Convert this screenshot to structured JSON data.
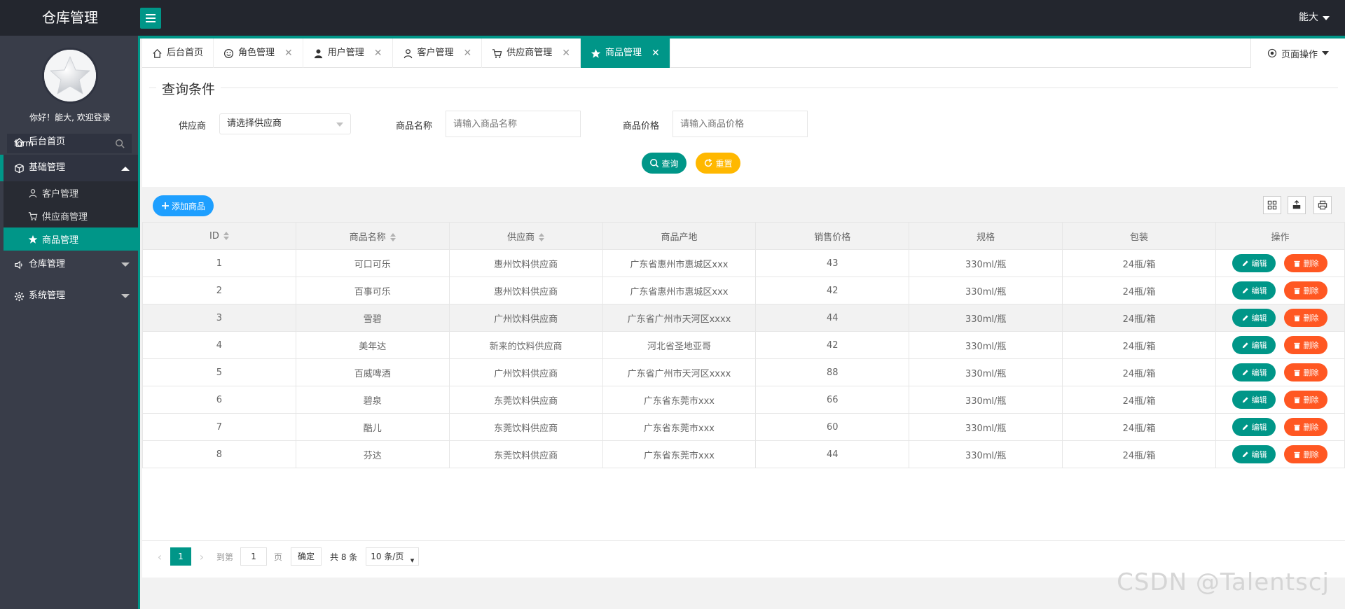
{
  "header": {
    "title": "仓库管理",
    "user": "能大"
  },
  "sidebar": {
    "welcome": "你好！能大, 欢迎登录",
    "search_value": "form",
    "items": [
      {
        "label": "后台首页",
        "icon": "home-icon"
      },
      {
        "label": "基础管理",
        "icon": "cube-icon"
      },
      {
        "label": "客户管理",
        "icon": "user-icon"
      },
      {
        "label": "供应商管理",
        "icon": "cart-icon"
      },
      {
        "label": "商品管理",
        "icon": "star-icon"
      },
      {
        "label": "仓库管理",
        "icon": "speaker-icon"
      },
      {
        "label": "系统管理",
        "icon": "gear-icon"
      }
    ]
  },
  "tabs": [
    {
      "label": "后台首页",
      "icon": "home-icon",
      "closable": false
    },
    {
      "label": "角色管理",
      "icon": "smile-icon",
      "closable": true
    },
    {
      "label": "用户管理",
      "icon": "user-icon",
      "closable": true
    },
    {
      "label": "客户管理",
      "icon": "user-outline-icon",
      "closable": true
    },
    {
      "label": "供应商管理",
      "icon": "cart-icon",
      "closable": true
    },
    {
      "label": "商品管理",
      "icon": "star-icon",
      "closable": true,
      "active": true
    }
  ],
  "tab_close_glyph": "✕",
  "page_ops_label": "页面操作",
  "query": {
    "legend": "查询条件",
    "supplier_label": "供应商",
    "supplier_value": "请选择供应商",
    "name_label": "商品名称",
    "name_placeholder": "请输入商品名称",
    "price_label": "商品价格",
    "price_placeholder": "请输入商品价格",
    "search_btn": "查询",
    "reset_btn": "重置"
  },
  "toolbar": {
    "add_btn": "添加商品"
  },
  "table": {
    "headers": [
      "ID",
      "商品名称",
      "供应商",
      "商品产地",
      "销售价格",
      "规格",
      "包装",
      "操作"
    ],
    "edit_label": "编辑",
    "delete_label": "删除",
    "rows": [
      [
        "1",
        "可口可乐",
        "惠州饮料供应商",
        "广东省惠州市惠城区xxx",
        "43",
        "330ml/瓶",
        "24瓶/箱"
      ],
      [
        "2",
        "百事可乐",
        "惠州饮料供应商",
        "广东省惠州市惠城区xxx",
        "42",
        "330ml/瓶",
        "24瓶/箱"
      ],
      [
        "3",
        "雪碧",
        "广州饮料供应商",
        "广东省广州市天河区xxxx",
        "44",
        "330ml/瓶",
        "24瓶/箱"
      ],
      [
        "4",
        "美年达",
        "新来的饮料供应商",
        "河北省圣地亚哥",
        "42",
        "330ml/瓶",
        "24瓶/箱"
      ],
      [
        "5",
        "百威啤酒",
        "广州饮料供应商",
        "广东省广州市天河区xxxx",
        "88",
        "330ml/瓶",
        "24瓶/箱"
      ],
      [
        "6",
        "碧泉",
        "东莞饮料供应商",
        "广东省东莞市xxx",
        "66",
        "330ml/瓶",
        "24瓶/箱"
      ],
      [
        "7",
        "酷儿",
        "东莞饮料供应商",
        "广东省东莞市xxx",
        "60",
        "330ml/瓶",
        "24瓶/箱"
      ],
      [
        "8",
        "芬达",
        "东莞饮料供应商",
        "广东省东莞市xxx",
        "44",
        "330ml/瓶",
        "24瓶/箱"
      ]
    ]
  },
  "pager": {
    "prev": "‹",
    "current": "1",
    "next": "›",
    "goto_label": "到第",
    "goto_value": "1",
    "page_unit": "页",
    "confirm": "确定",
    "total": "共 8 条",
    "page_size": "10 条/页"
  },
  "watermark": "CSDN @Talentscj",
  "colors": {
    "accent": "#009688",
    "header_bg": "#23262e",
    "sidebar_bg": "#393d49",
    "blue": "#1e9fff",
    "warn": "#ffb800",
    "danger": "#ff5722"
  }
}
